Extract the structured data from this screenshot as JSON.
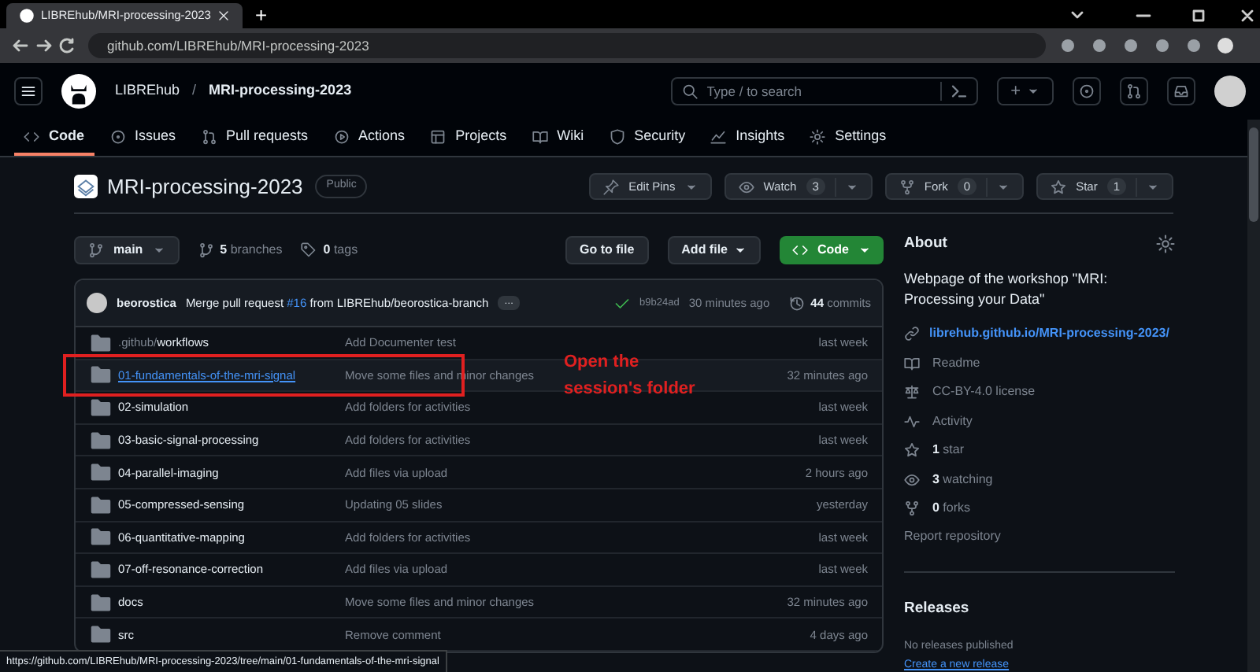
{
  "browser": {
    "tab_title": "LIBREhub/MRI-processing-2023",
    "new_tab": "+",
    "url": "github.com/LIBREhub/MRI-processing-2023"
  },
  "header": {
    "owner": "LIBREhub",
    "separator": "/",
    "repo": "MRI-processing-2023",
    "search_placeholder": "Type / to search",
    "new_label": "+"
  },
  "nav": [
    {
      "label": "Code",
      "selected": true
    },
    {
      "label": "Issues",
      "selected": false
    },
    {
      "label": "Pull requests",
      "selected": false
    },
    {
      "label": "Actions",
      "selected": false
    },
    {
      "label": "Projects",
      "selected": false
    },
    {
      "label": "Wiki",
      "selected": false
    },
    {
      "label": "Security",
      "selected": false
    },
    {
      "label": "Insights",
      "selected": false
    },
    {
      "label": "Settings",
      "selected": false
    }
  ],
  "repo_title": {
    "name": "MRI-processing-2023",
    "visibility": "Public"
  },
  "repo_actions": [
    {
      "label": "Edit Pins"
    },
    {
      "label": "Watch",
      "count": "3"
    },
    {
      "label": "Fork",
      "count": "0"
    },
    {
      "label": "Star",
      "count": "1"
    }
  ],
  "toolbar": {
    "branch": "main",
    "branches": "**5** branches",
    "tags": "**0** tags",
    "go_to_file": "Go to file",
    "add_file": "Add file",
    "code": "Code"
  },
  "commit": {
    "author": "beorostica",
    "message_before": "Merge pull request",
    "pr_link": "#16",
    "message_after": "from LIBREhub/beorostica-branch",
    "ellipsis": "…",
    "hash": "b9b24ad",
    "time": "30 minutes ago",
    "commits": "**44** commits"
  },
  "files": [
    {
      "name_prefix": ".github/",
      "name": "workflows",
      "message": "Add Documenter test",
      "time": "last week",
      "hovered": false
    },
    {
      "name": "01-fundamentals-of-the-mri-signal",
      "message": "Move some files and minor changes",
      "time": "32 minutes ago",
      "hovered": true
    },
    {
      "name": "02-simulation",
      "message": "Add folders for activities",
      "time": "last week",
      "hovered": false
    },
    {
      "name": "03-basic-signal-processing",
      "message": "Add folders for activities",
      "time": "last week",
      "hovered": false
    },
    {
      "name": "04-parallel-imaging",
      "message": "Add files via upload",
      "time": "2 hours ago",
      "hovered": false
    },
    {
      "name": "05-compressed-sensing",
      "message": "Updating 05 slides",
      "time": "yesterday",
      "hovered": false
    },
    {
      "name": "06-quantitative-mapping",
      "message": "Add folders for activities",
      "time": "last week",
      "hovered": false
    },
    {
      "name": "07-off-resonance-correction",
      "message": "Add files via upload",
      "time": "last week",
      "hovered": false
    },
    {
      "name": "docs",
      "message": "Move some files and minor changes",
      "time": "32 minutes ago",
      "hovered": false
    },
    {
      "name": "src",
      "message": "Remove comment",
      "time": "4 days ago",
      "hovered": false
    }
  ],
  "annotation": {
    "text": "Open the session's folder"
  },
  "about": {
    "title": "About",
    "description": "Webpage of the workshop \"MRI: Processing your Data\"",
    "link": "librehub.github.io/MRI-processing-2023/",
    "items": [
      "Readme",
      "CC-BY-4.0 license",
      "Activity",
      "**1** star",
      "**3** watching",
      "**0** forks"
    ],
    "report": "Report repository"
  },
  "releases": {
    "title": "Releases",
    "none": "No releases published",
    "create": "Create a new release"
  },
  "status_url": "https://github.com/LIBREhub/MRI-processing-2023/tree/main/01-fundamentals-of-the-mri-signal"
}
